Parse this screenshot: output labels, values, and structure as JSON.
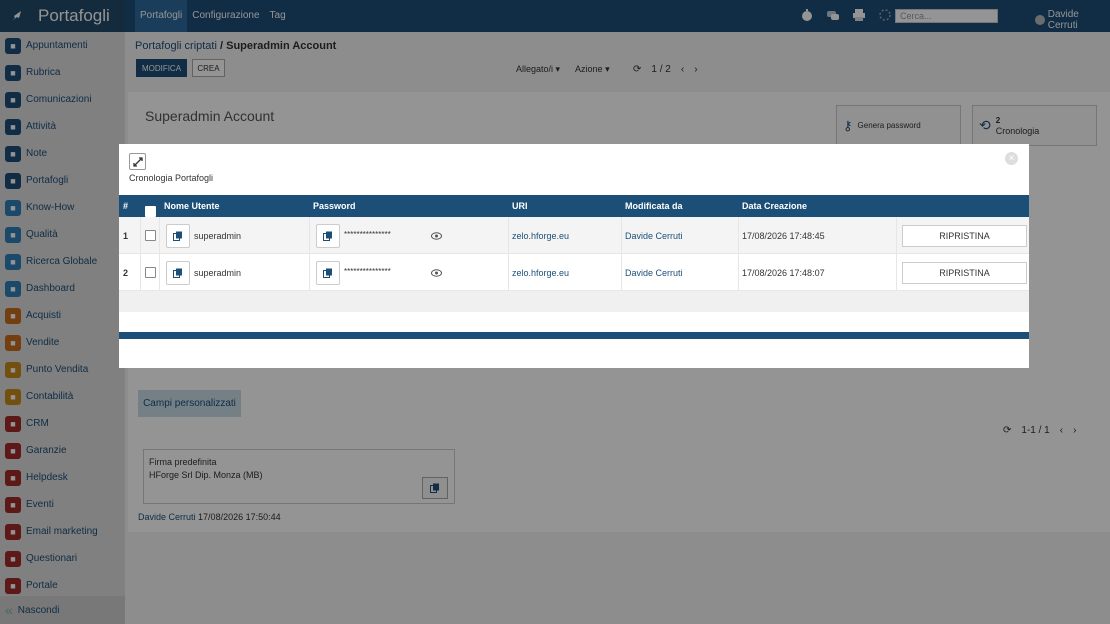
{
  "topbar": {
    "brand": "Portafogli",
    "nav": [
      "Portafogli",
      "Configurazione",
      "Tag"
    ],
    "search_placeholder": "Cerca...",
    "user": "Davide Cerruti"
  },
  "sidebar": {
    "items": [
      {
        "label": "Appuntamenti",
        "icon": "calendar-icon",
        "color": "#1c4f78"
      },
      {
        "label": "Rubrica",
        "icon": "contacts-icon",
        "color": "#1c4f78"
      },
      {
        "label": "Comunicazioni",
        "icon": "chat-icon",
        "color": "#1c4f78"
      },
      {
        "label": "Attività",
        "icon": "check-icon",
        "color": "#1c4f78"
      },
      {
        "label": "Note",
        "icon": "note-icon",
        "color": "#1c4f78"
      },
      {
        "label": "Portafogli",
        "icon": "lock-icon",
        "color": "#1c4f78"
      },
      {
        "label": "Know-How",
        "icon": "brain-icon",
        "color": "#2f7fb6"
      },
      {
        "label": "Qualità",
        "icon": "quality-icon",
        "color": "#2f7fb6"
      },
      {
        "label": "Ricerca Globale",
        "icon": "search-icon",
        "color": "#2f7fb6"
      },
      {
        "label": "Dashboard",
        "icon": "dashboard-icon",
        "color": "#2f7fb6"
      },
      {
        "label": "Acquisti",
        "icon": "cart-icon",
        "color": "#c76b1c"
      },
      {
        "label": "Vendite",
        "icon": "chart-icon",
        "color": "#c76b1c"
      },
      {
        "label": "Punto Vendita",
        "icon": "store-icon",
        "color": "#c98a1c"
      },
      {
        "label": "Contabilità",
        "icon": "accounting-icon",
        "color": "#c98a1c"
      },
      {
        "label": "CRM",
        "icon": "crm-icon",
        "color": "#a02a2a"
      },
      {
        "label": "Garanzie",
        "icon": "shield-icon",
        "color": "#a02a2a"
      },
      {
        "label": "Helpdesk",
        "icon": "headset-icon",
        "color": "#a02a2a"
      },
      {
        "label": "Eventi",
        "icon": "event-icon",
        "color": "#a02a2a"
      },
      {
        "label": "Email marketing",
        "icon": "send-icon",
        "color": "#a02a2a"
      },
      {
        "label": "Questionari",
        "icon": "survey-icon",
        "color": "#a02a2a"
      },
      {
        "label": "Portale",
        "icon": "globe-icon",
        "color": "#a02a2a"
      }
    ],
    "collapse_label": "Nascondi"
  },
  "main": {
    "breadcrumb_link": "Portafogli criptati",
    "breadcrumb_sep": "/",
    "breadcrumb_current": "Superadmin Account",
    "btn_modifica": "MODIFICA",
    "btn_crea": "CREA",
    "menu_allegati": "Allegato/i ▾",
    "menu_azione": "Azione ▾",
    "pager": "1 / 2",
    "card_title": "Superadmin Account",
    "genera_password": "Genera password",
    "cronologia_count": "2",
    "cronologia_label": "Cronologia",
    "campi_label": "Campi personalizzati",
    "pager2": "1-1 / 1",
    "firma_title": "Firma predefinita",
    "firma_text": "HForge Srl Dip. Monza (MB)",
    "footer_user": "Davide Cerruti",
    "footer_date": "17/08/2026 17:50:44"
  },
  "modal": {
    "title": "Cronologia Portafogli",
    "columns": {
      "num": "#",
      "user": "Nome Utente",
      "password": "Password",
      "uri": "URI",
      "modified_by": "Modificata da",
      "created": "Data Creazione"
    },
    "rows": [
      {
        "num": "1",
        "user": "superadmin",
        "password": "***************",
        "uri": "zelo.hforge.eu",
        "modified_by": "Davide Cerruti",
        "created": "17/08/2026 17:48:45",
        "action": "RIPRISTINA"
      },
      {
        "num": "2",
        "user": "superadmin",
        "password": "***************",
        "uri": "zelo.hforge.eu",
        "modified_by": "Davide Cerruti",
        "created": "17/08/2026 17:48:07",
        "action": "RIPRISTINA"
      }
    ]
  }
}
